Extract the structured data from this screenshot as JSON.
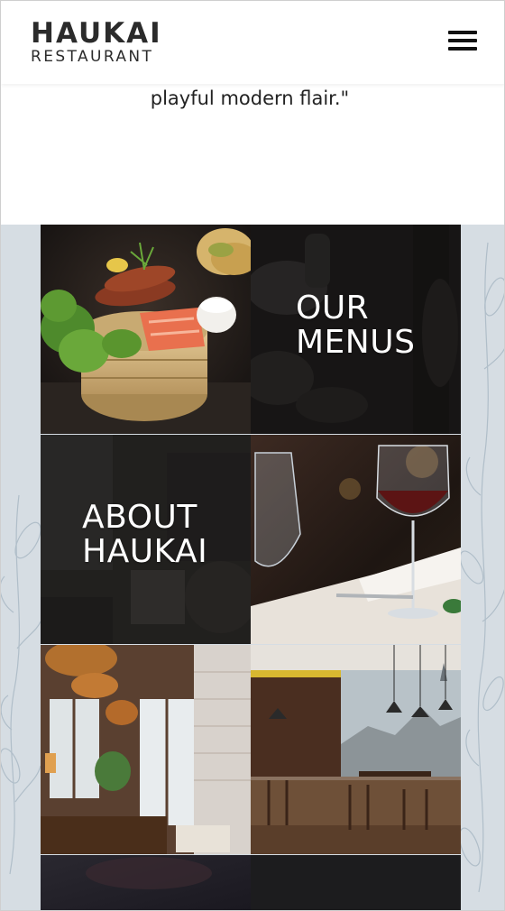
{
  "header": {
    "logo_main": "HAUKAI",
    "logo_sub": "RESTAURANT",
    "menu_icon": "hamburger-menu-icon"
  },
  "quote": {
    "text": "playful modern flair.\""
  },
  "tiles": {
    "menus_label_line1": "OUR",
    "menus_label_line2": "MENUS",
    "about_label_line1": "ABOUT",
    "about_label_line2": "HAUKAI"
  },
  "colors": {
    "section_bg": "#d6dde3",
    "text_dark": "#2b2b2b",
    "tile_text": "#ffffff"
  }
}
